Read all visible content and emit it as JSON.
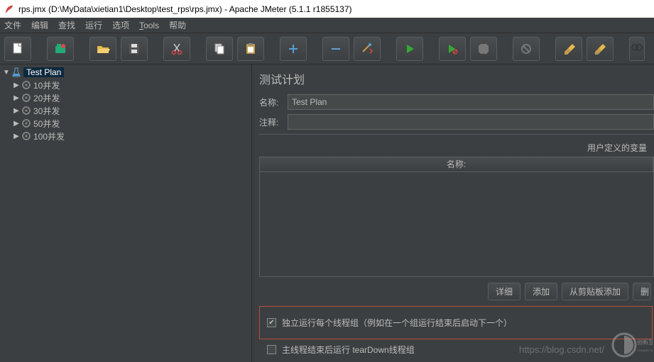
{
  "title": "rps.jmx (D:\\MyData\\xietian1\\Desktop\\test_rps\\rps.jmx) - Apache JMeter (5.1.1 r1855137)",
  "menu": {
    "file": "文件",
    "edit": "编辑",
    "search": "查找",
    "run": "运行",
    "options": "选项",
    "tools": "Tools",
    "help": "帮助"
  },
  "toolbar": {
    "new": "new",
    "templates": "templates",
    "open": "open",
    "save": "save",
    "cut": "cut",
    "copy": "copy",
    "paste": "paste",
    "plus": "+",
    "minus": "−",
    "wand": "wand",
    "start": "start",
    "start_no_pause": "start-no-pause",
    "stop": "stop",
    "shutdown": "shutdown",
    "clear": "clear-one",
    "clear_all": "clear-all",
    "search_btn": "search"
  },
  "tree": {
    "root": "Test Plan",
    "items": [
      {
        "label": "10并发"
      },
      {
        "label": "20并发"
      },
      {
        "label": "30并发"
      },
      {
        "label": "50并发"
      },
      {
        "label": "100并发"
      }
    ]
  },
  "panel": {
    "heading": "测试计划",
    "name_label": "名称:",
    "name_value": "Test Plan",
    "comment_label": "注释:",
    "comment_value": "",
    "vars_heading": "用户定义的变量",
    "col_name": "名称:",
    "buttons": {
      "detail": "详细",
      "add": "添加",
      "from_clip": "从剪贴板添加",
      "delete": "删"
    },
    "opt1": "独立运行每个线程组（例如在一个组运行结束后启动下一个）",
    "opt2": "主线程结束后运行 tearDown线程组"
  },
  "watermark": "https://blog.csdn.net/",
  "logo_text": "创新互联"
}
